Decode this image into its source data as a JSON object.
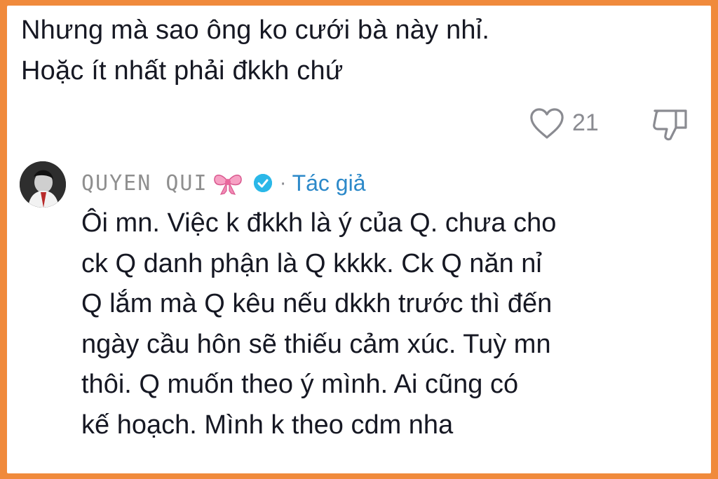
{
  "comment": {
    "lines": [
      "Nhưng mà sao ông ko cưới bà này nhỉ.",
      "Hoặc ít nhất phải đkkh chứ"
    ],
    "like_count": "21",
    "icons": {
      "like": "heart-icon",
      "dislike": "thumbs-down-icon"
    }
  },
  "reply": {
    "username": "QUYEN QUI",
    "username_emoji": "bow-emoji",
    "separator": "·",
    "author_tag": "Tác giả",
    "accent_color": "#2c89c9",
    "lines": [
      "Ôi mn. Việc k đkkh là ý của Q. chưa cho",
      "ck Q danh phận là Q kkkk. Ck Q năn nỉ",
      "Q lắm mà Q kêu nếu dkkh trước thì đến",
      "ngày cầu hôn sẽ thiếu cảm xúc. Tuỳ mn",
      "thôi. Q muốn theo ý mình. Ai cũng có",
      "kế hoạch. Mình k theo cdm nha"
    ]
  },
  "frame_color": "#f08a3c"
}
